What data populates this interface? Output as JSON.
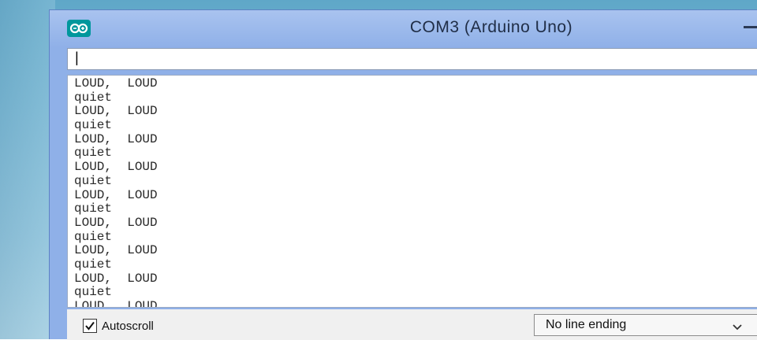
{
  "window": {
    "title": "COM3 (Arduino Uno)",
    "app_icon": "arduino-infinity-icon"
  },
  "send_field": {
    "value": "|"
  },
  "serial_output": {
    "lines": [
      "LOUD,  LOUD",
      "quiet",
      "LOUD,  LOUD",
      "quiet",
      "LOUD,  LOUD",
      "quiet",
      "LOUD,  LOUD",
      "quiet",
      "LOUD,  LOUD",
      "quiet",
      "LOUD,  LOUD",
      "quiet",
      "LOUD,  LOUD",
      "quiet",
      "LOUD,  LOUD",
      "quiet",
      "LOUD,  LOUD"
    ]
  },
  "bottom_bar": {
    "autoscroll_label": "Autoscroll",
    "autoscroll_checked": true,
    "line_ending_selected": "No line ending"
  },
  "colors": {
    "titlebar": "#8fb0e8",
    "arduino_teal": "#00979c"
  }
}
